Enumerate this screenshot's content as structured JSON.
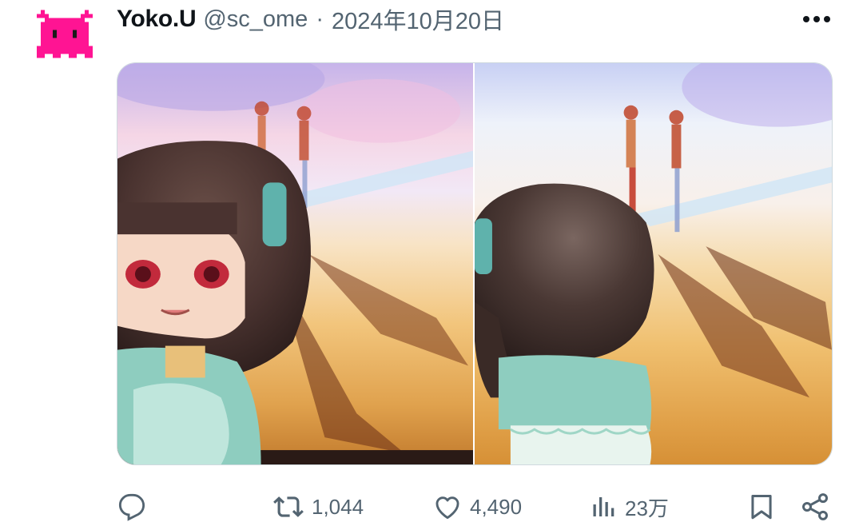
{
  "post": {
    "author_name": "Yoko.U",
    "author_handle": "@sc_ome",
    "separator": "·",
    "date": "2024年10月20日"
  },
  "icons": {
    "avatar": "pink-pixel-invader-icon",
    "more": "more-horizontal-icon",
    "reply": "reply-bubble-icon",
    "repost": "repost-icon",
    "like": "heart-icon",
    "views": "views-bars-icon",
    "bookmark": "bookmark-icon",
    "share": "share-icon"
  },
  "colors": {
    "avatar_pink": "#ff1493",
    "text_primary": "#0f1419",
    "text_secondary": "#536471",
    "border": "#cfd9de"
  },
  "actions": {
    "reposts": "1,044",
    "likes": "4,490",
    "views": "23万"
  }
}
